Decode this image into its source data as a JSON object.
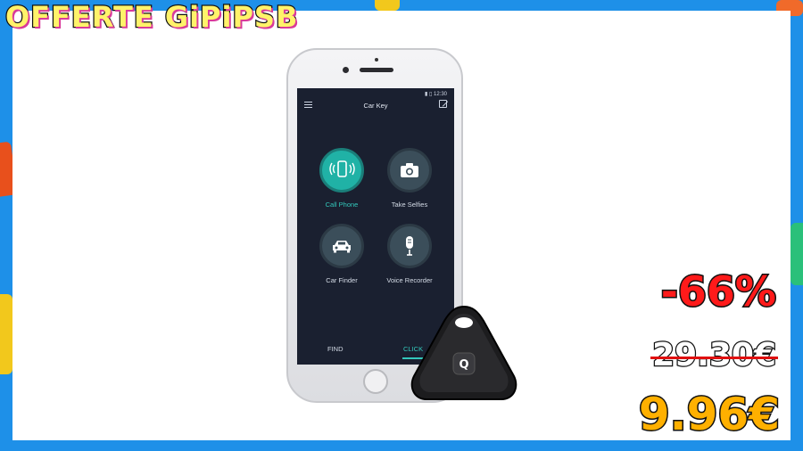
{
  "brand": {
    "text": "OFFERTE GiPiPSB"
  },
  "phone": {
    "status_time": "12:30",
    "nav_title": "Car Key",
    "tiles": [
      {
        "label": "Call Phone",
        "icon": "phone-ring-icon",
        "active": true
      },
      {
        "label": "Take Selfies",
        "icon": "camera-icon",
        "active": false
      },
      {
        "label": "Car Finder",
        "icon": "car-icon",
        "active": false
      },
      {
        "label": "Voice Recorder",
        "icon": "microphone-icon",
        "active": false
      }
    ],
    "tabs": [
      {
        "label": "FIND",
        "active": false
      },
      {
        "label": "CLICK",
        "active": true
      }
    ]
  },
  "price": {
    "discount": "-66%",
    "old": "29.30€",
    "new": "9.96€"
  },
  "colors": {
    "frame": "#1e90e8",
    "accent_teal": "#20b2a6",
    "discount_red": "#ff1a1a",
    "price_orange": "#ffb000",
    "brand_yellow": "#fff36a"
  }
}
